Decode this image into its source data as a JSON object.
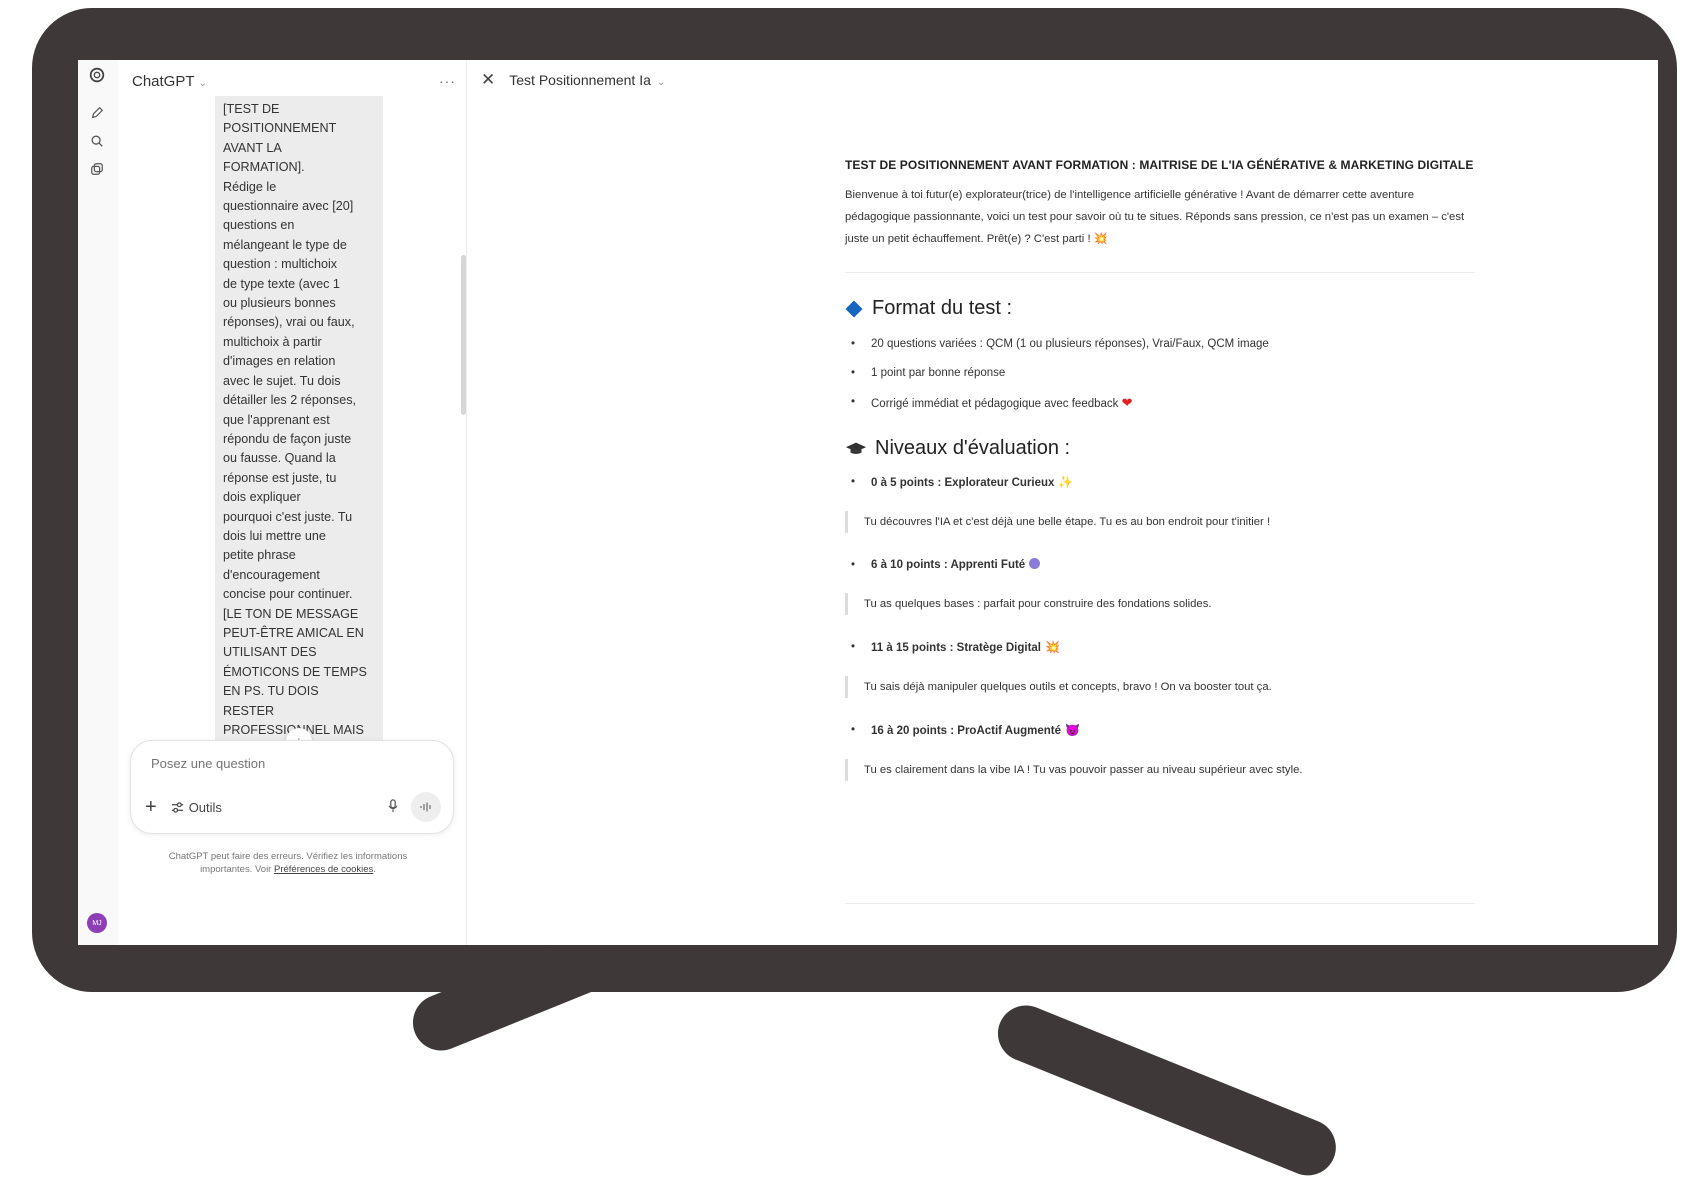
{
  "sidebar": {
    "title": "ChatGPT",
    "menu_icon": "more-horizontal-icon",
    "message_text": "[TEST DE\nPOSITIONNEMENT\nAVANT LA\nFORMATION].\nRédige le\nquestionnaire avec [20]\nquestions en\nmélangeant le type de\nquestion : multichoix\nde type texte (avec 1\nou plusieurs bonnes\nréponses), vrai ou faux,\nmultichoix à partir\nd'images en relation\navec le sujet. Tu dois\ndétailler les 2 réponses,\nque l'apprenant est\nrépondu de façon juste\nou fausse. Quand la\nréponse est juste, tu\ndois expliquer\npourquoi c'est juste. Tu\ndois lui mettre une\npetite phrase\nd'encouragement\nconcise pour continuer.\n[LE TON DE MESSAGE\nPEUT-ÊTRE AMICAL EN\nUTILISANT DES\nÉMOTICONS DE TEMPS\nEN  PS. TU DOIS\nRESTER\nPROFESSIONNEL MAIS",
    "composer_placeholder": "Posez une question",
    "tools_label": "Outils",
    "disclaimer_text": "ChatGPT peut faire des erreurs. Vérifiez les informations importantes. Voir",
    "disclaimer_link": "Préférences de cookies",
    "disclaimer_end": ".",
    "avatar_initials": "MJ"
  },
  "canvas": {
    "title": "Test Positionnement Ia",
    "heading": "TEST DE POSITIONNEMENT AVANT FORMATION : MAITRISE DE L'IA GÉNÉRATIVE & MARKETING DIGITALE",
    "intro": "Bienvenue à toi futur(e) explorateur(trice) de l'intelligence artificielle générative ! Avant de démarrer cette aventure pédagogique passionnante, voici un test pour savoir où tu te situes. Réponds sans pression, ce n'est pas un examen – c'est juste un petit échauffement. Prêt(e) ? C'est parti !",
    "intro_emoji": "💥",
    "format_title": "Format du test :",
    "format_items": [
      "20 questions variées : QCM (1 ou plusieurs réponses), Vrai/Faux, QCM image",
      "1 point par bonne réponse",
      "Corrigé immédiat et pédagogique avec feedback"
    ],
    "levels_title": "Niveaux d'évaluation :",
    "levels": [
      {
        "label": "0 à 5 points : Explorateur Curieux",
        "emoji": "✨",
        "desc": "Tu découvres l'IA et c'est déjà une belle étape. Tu es au bon endroit pour t'initier !"
      },
      {
        "label": "6 à 10 points : Apprenti Futé",
        "emoji": "",
        "desc": "Tu as quelques bases : parfait pour construire des fondations solides."
      },
      {
        "label": "11 à 15 points : Stratège Digital",
        "emoji": "💥",
        "desc": "Tu sais déjà manipuler quelques outils et concepts, bravo ! On va booster tout ça."
      },
      {
        "label": "16 à 20 points : ProActif Augmenté",
        "emoji": "😈",
        "desc": "Tu es clairement dans la vibe IA ! Tu vas pouvoir passer au niveau supérieur avec style."
      }
    ]
  }
}
